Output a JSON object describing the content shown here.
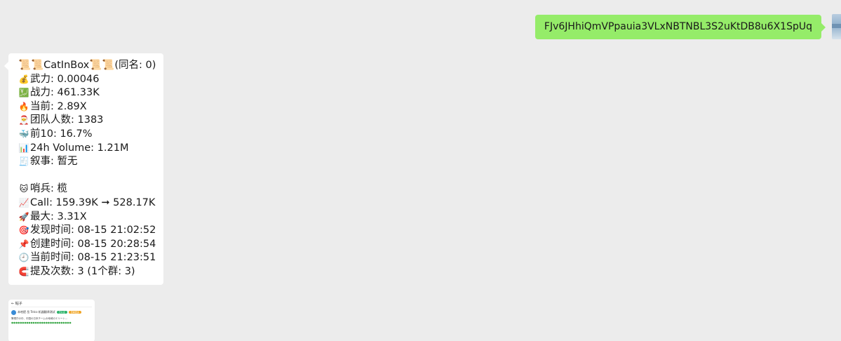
{
  "outgoing": {
    "text": "FJv6JHhiQmVPpauia3VLxNBTNBL3S2uKtDB8u6X1SpUq"
  },
  "incoming": {
    "title_prefix_emoji": "📜📜",
    "title": "CatInBox",
    "title_suffix_emoji": "📜📜",
    "title_extra": "(同名: 0)",
    "lines": [
      {
        "icon": "💰",
        "text": "武力: 0.00046"
      },
      {
        "icon": "💹",
        "text": "战力: 461.33K"
      },
      {
        "icon": "🔥",
        "text": "当前: 2.89X"
      },
      {
        "icon": "🎅",
        "text": "团队人数: 1383"
      },
      {
        "icon": "🐳",
        "text": "前10: 16.7%"
      },
      {
        "icon": "📊",
        "text": "24h Volume: 1.21M"
      },
      {
        "icon": "🧾",
        "text": "叙事: 暂无"
      }
    ],
    "lines2": [
      {
        "icon": "🐱",
        "text": "哨兵: 榄"
      },
      {
        "icon": "📈",
        "text": "Call: 159.39K ➞ 528.17K"
      },
      {
        "icon": "🚀",
        "text": "最大: 3.31X"
      },
      {
        "icon": "🎯",
        "text": "发现时间: 08-15 21:02:52"
      },
      {
        "icon": "📌",
        "text": "创建时间: 08-15 20:28:54"
      },
      {
        "icon": "🕘",
        "text": "当前时间: 08-15 21:23:51"
      },
      {
        "icon": "🧲",
        "text": "提及次数: 3 (1个群: 3)"
      }
    ]
  },
  "thumbnail": {
    "header": "帖子",
    "user": "本哈提 岳 Telco 机器翻译测试",
    "badge1": "已认证",
    "badge2": "查看更多",
    "text": "警視庁の中、中国の日本チームの地域のエリート..."
  },
  "colors": {
    "background": "#ececec",
    "outgoing_bubble": "#95ec69",
    "incoming_bubble": "#ffffff"
  }
}
